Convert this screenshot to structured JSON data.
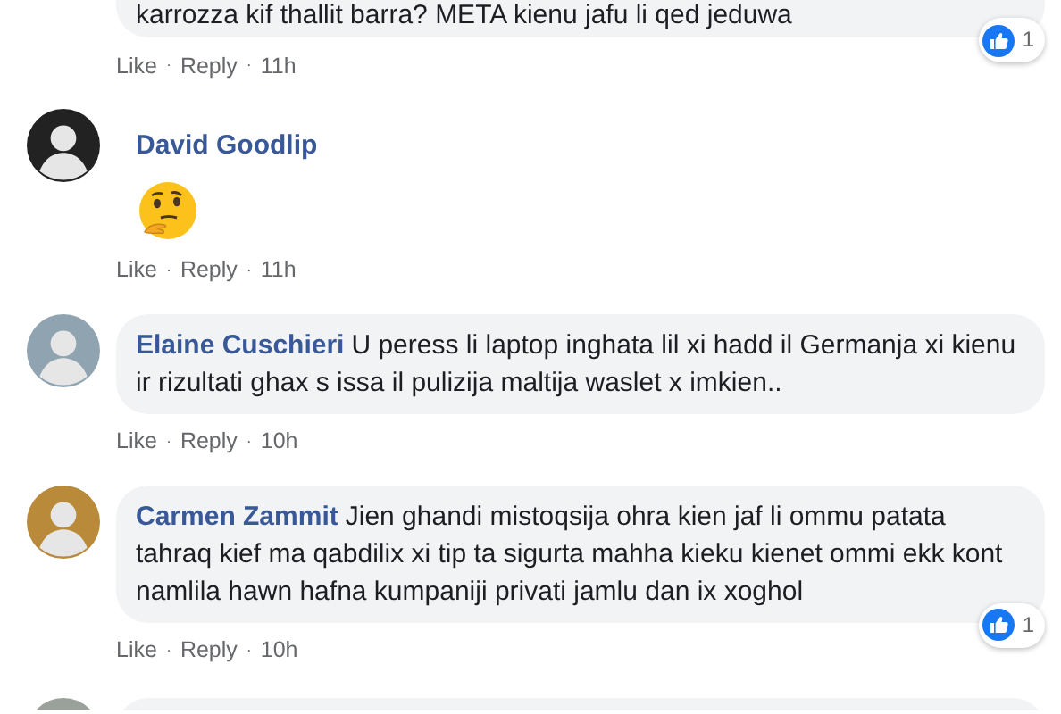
{
  "comments": [
    {
      "kind": "text",
      "text": "karrozza kif thallit barra? META kienu jafu li qed jeduwa",
      "reaction_count": "1",
      "actions": [
        "Like",
        "Reply"
      ],
      "separators": [
        "·",
        "·"
      ],
      "time": "11h"
    },
    {
      "kind": "emoji",
      "author": "David Goodlip",
      "actions": [
        "Like",
        "Reply"
      ],
      "separators": [
        "·",
        "·"
      ],
      "time": "11h"
    },
    {
      "kind": "text",
      "author": "Elaine Cuschieri",
      "text": "U peress li laptop inghata lil xi hadd il Germanja xi kienu ir rizultati ghax s issa il pulizija maltija waslet x imkien..",
      "actions": [
        "Like",
        "Reply"
      ],
      "separators": [
        "·",
        "·"
      ],
      "time": "10h"
    },
    {
      "kind": "text",
      "author": "Carmen Zammit",
      "text": "Jien ghandi mistoqsija ohra kien jaf li ommu patata tahraq kief ma qabdilix xi tip ta sigurta mahha kieku kienet ommi ekk kont namlila hawn hafna kumpaniji privati jamlu dan ix xoghol",
      "reaction_count": "1",
      "actions": [
        "Like",
        "Reply"
      ],
      "separators": [
        "·",
        "·"
      ],
      "time": "10h"
    },
    {
      "kind": "stub"
    }
  ]
}
